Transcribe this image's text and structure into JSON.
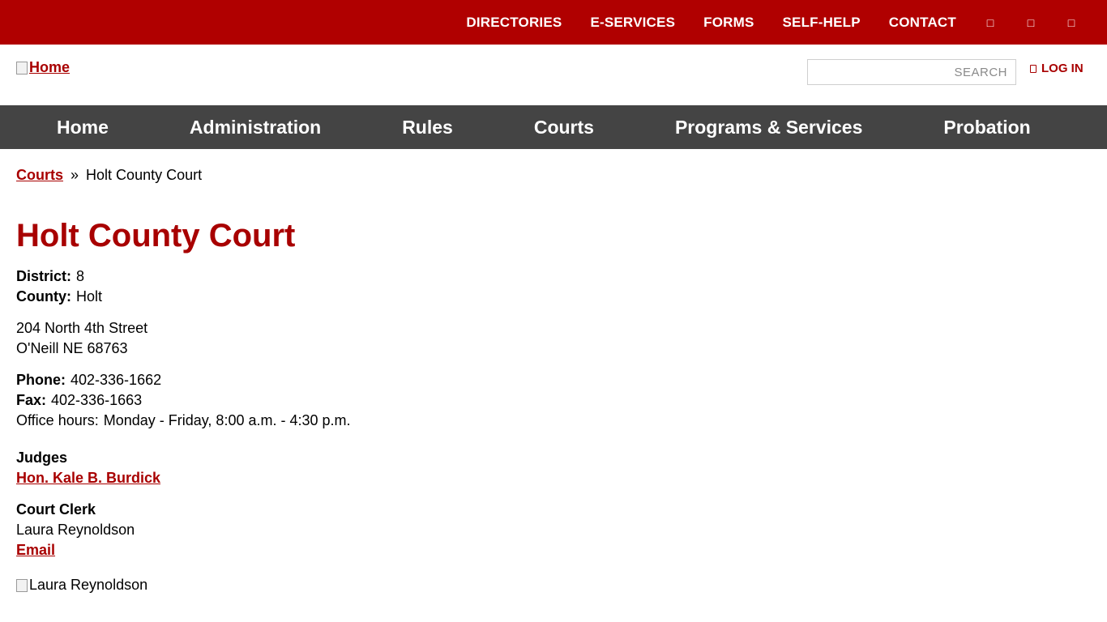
{
  "topbar": {
    "links": [
      "DIRECTORIES",
      "E-SERVICES",
      "FORMS",
      "SELF-HELP",
      "CONTACT"
    ],
    "icons": [
      "facebook-icon",
      "twitter-icon",
      "youtube-icon"
    ]
  },
  "header": {
    "logo_alt": "Home",
    "search_placeholder": "SEARCH",
    "login_label": "LOG IN"
  },
  "nav": {
    "items": [
      "Home",
      "Administration",
      "Rules",
      "Courts",
      "Programs & Services",
      "Probation"
    ]
  },
  "breadcrumb": {
    "parent": "Courts",
    "separator": "»",
    "current": "Holt County Court"
  },
  "page": {
    "title": "Holt County Court",
    "district_label": "District:",
    "district_value": "8",
    "county_label": "County:",
    "county_value": "Holt",
    "address_line1": "204 North 4th Street",
    "address_line2": "O'Neill NE 68763",
    "phone_label": "Phone:",
    "phone_value": "402-336-1662",
    "fax_label": "Fax:",
    "fax_value": "402-336-1663",
    "hours_label": "Office hours:",
    "hours_value": "Monday - Friday, 8:00 a.m. - 4:30 p.m.",
    "judges_heading": "Judges",
    "judge_name": "Hon. Kale B. Burdick",
    "clerk_heading": "Court Clerk",
    "clerk_name": "Laura Reynoldson",
    "email_label": "Email",
    "clerk_img_alt": "Laura Reynoldson"
  },
  "colors": {
    "brand_red": "#b00000",
    "link_red": "#a80000",
    "nav_gray": "#444444"
  }
}
